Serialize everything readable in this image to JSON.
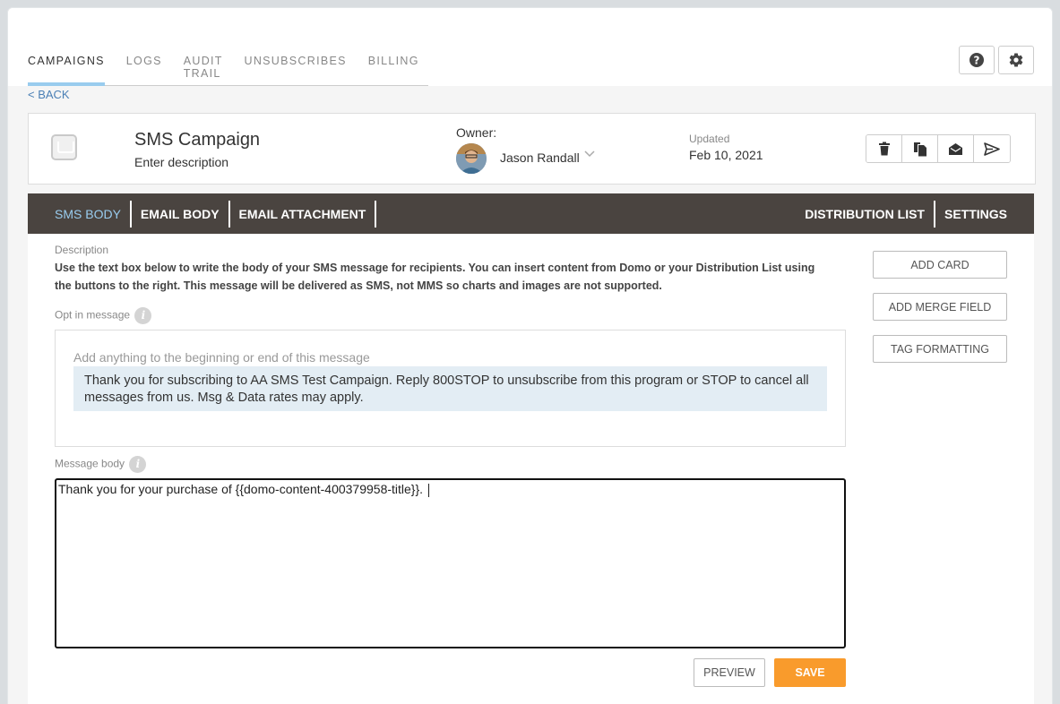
{
  "tabs": [
    "CAMPAIGNS",
    "LOGS",
    "AUDIT TRAIL",
    "UNSUBSCRIBES",
    "BILLING"
  ],
  "active_tab": "CAMPAIGNS",
  "back_label": "< BACK",
  "campaign": {
    "title": "SMS Campaign",
    "description": "Enter description",
    "owner_label": "Owner:",
    "owner_name": "Jason Randall",
    "updated_label": "Updated",
    "updated_date": "Feb 10, 2021"
  },
  "subnav": {
    "sms_body": "SMS BODY",
    "email_body": "EMAIL BODY",
    "email_attachment": "EMAIL ATTACHMENT",
    "distribution_list": "DISTRIBUTION LIST",
    "settings": "SETTINGS"
  },
  "body": {
    "description_label": "Description",
    "description_text": "Use the text box below to write the body of your SMS message for recipients. You can insert content from Domo or your Distribution List using the buttons to the right. This message will be delivered as SMS, not MMS so charts and images are not supported.",
    "opt_in_label": "Opt in message",
    "opt_in_placeholder": "Add anything to the beginning or end of this message",
    "opt_in_text": "Thank you for subscribing to AA SMS Test Campaign. Reply 800STOP to unsubscribe from this program or STOP to cancel all messages from us. Msg & Data rates may apply.",
    "message_label": "Message body",
    "message_text": "Thank you for your purchase of {{domo-content-400379958-title}}."
  },
  "side_buttons": {
    "add_card": "ADD CARD",
    "add_merge_field": "ADD MERGE FIELD",
    "tag_formatting": "TAG FORMATTING"
  },
  "footer_buttons": {
    "preview": "PREVIEW",
    "save": "SAVE"
  },
  "colors": {
    "accent": "#99ccee",
    "subnav_bg": "#4a4440",
    "save": "#f99b2c",
    "link": "#4a7fb5"
  },
  "icons": [
    "help-icon",
    "gear-icon",
    "trash-icon",
    "copy-icon",
    "envelope-open-icon",
    "send-icon",
    "campaign-inbox-icon",
    "chevron-down-icon",
    "info-icon"
  ]
}
